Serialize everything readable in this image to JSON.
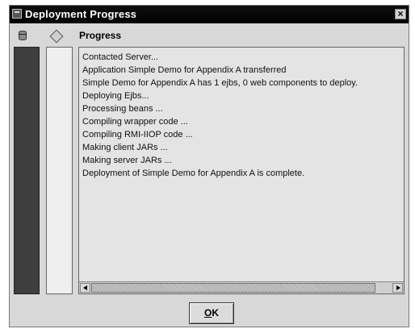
{
  "window": {
    "title": "Deployment Progress",
    "close_label": "×"
  },
  "columns": {
    "database_icon": "database-icon",
    "diamond_icon": "diamond-icon",
    "progress_header": "Progress"
  },
  "log": {
    "lines": [
      "Contacted Server...",
      "Application Simple Demo for Appendix A transferred",
      "Simple Demo for Appendix A has 1  ejbs, 0 web components to deploy.",
      "Deploying Ejbs...",
      "Processing beans ...",
      "Compiling wrapper code ...",
      "Compiling RMI-IIOP code ...",
      "Making client JARs ...",
      "Making server JARs ...",
      "Deployment of Simple Demo for Appendix A is complete."
    ]
  },
  "buttons": {
    "ok_mnemonic": "O",
    "ok_rest": "K"
  }
}
